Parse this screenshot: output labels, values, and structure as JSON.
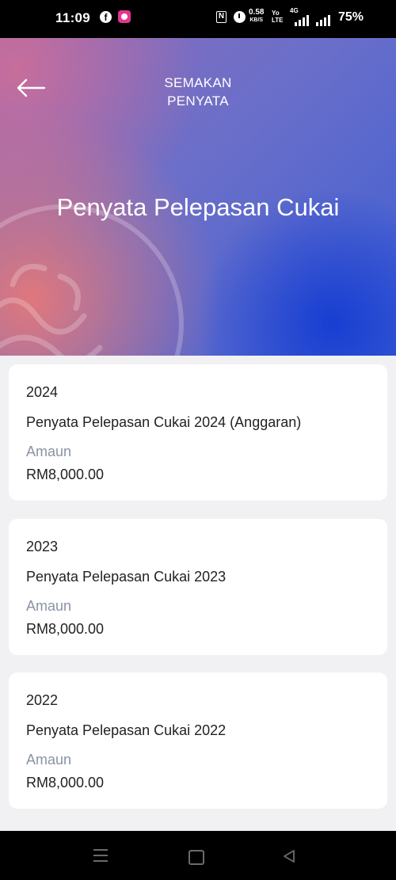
{
  "status_bar": {
    "time": "11:09",
    "speed_value": "0.58",
    "speed_unit": "KB/S",
    "volte_top": "Yo",
    "volte_bottom": "LTE",
    "network": "4G",
    "battery": "75%"
  },
  "header": {
    "top_title_line1": "SEMAKAN",
    "top_title_line2": "PENYATA",
    "page_title": "Penyata Pelepasan Cukai"
  },
  "statements": [
    {
      "year": "2024",
      "title": "Penyata Pelepasan Cukai 2024 (Anggaran)",
      "amount_label": "Amaun",
      "amount": "RM8,000.00"
    },
    {
      "year": "2023",
      "title": "Penyata Pelepasan Cukai 2023",
      "amount_label": "Amaun",
      "amount": "RM8,000.00"
    },
    {
      "year": "2022",
      "title": "Penyata Pelepasan Cukai 2022",
      "amount_label": "Amaun",
      "amount": "RM8,000.00"
    }
  ],
  "icons": {
    "back": "arrow-left-icon",
    "facebook": "facebook-icon",
    "nfc": "nfc-icon",
    "alarm": "alarm-icon",
    "nav_menu": "menu-icon",
    "nav_home": "home-icon",
    "nav_back": "triangle-back-icon"
  },
  "colors": {
    "accent_blue": "#3f5fd3",
    "label_gray": "#8a93a3"
  }
}
